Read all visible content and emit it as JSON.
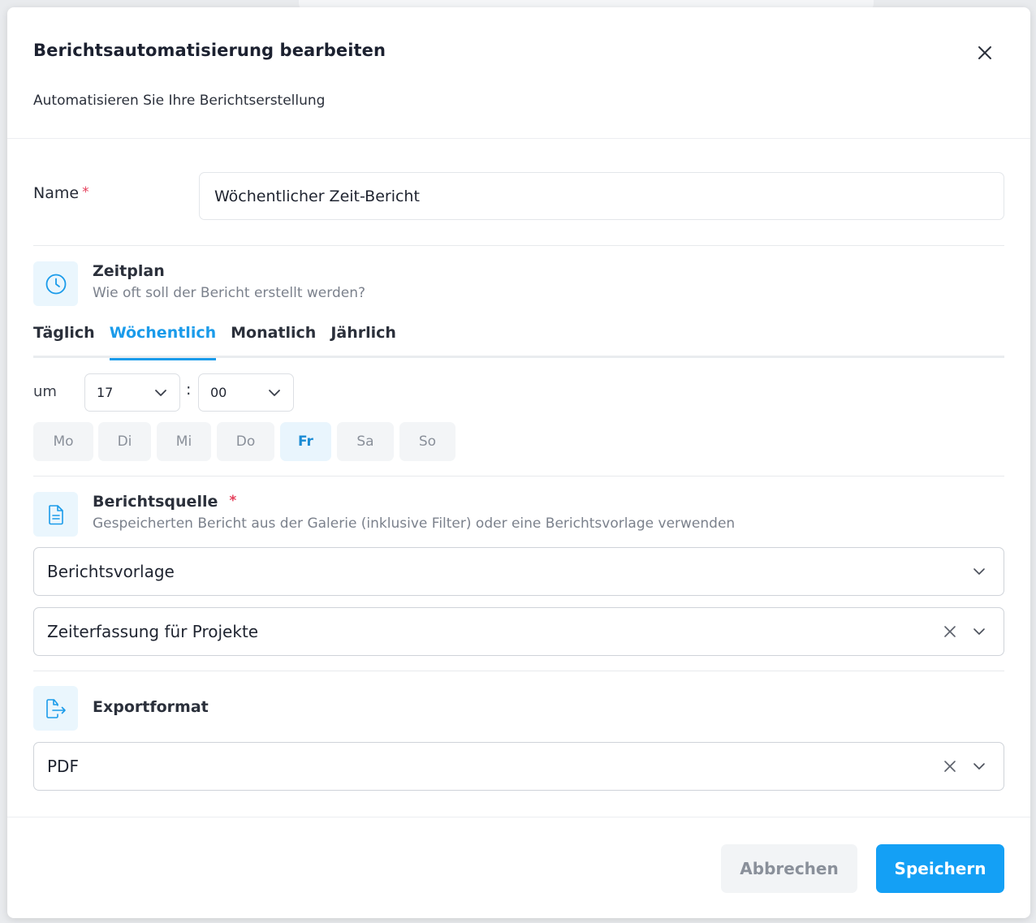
{
  "modal": {
    "title": "Berichtsautomatisierung bearbeiten",
    "subtitle": "Automatisieren Sie Ihre Berichtserstellung"
  },
  "name_field": {
    "label": "Name",
    "required": "*",
    "value": "Wöchentlicher Zeit-Bericht"
  },
  "schedule": {
    "title": "Zeitplan",
    "description": "Wie oft soll der Bericht erstellt werden?",
    "tabs": [
      {
        "label": "Täglich",
        "active": false
      },
      {
        "label": "Wöchentlich",
        "active": true
      },
      {
        "label": "Monatlich",
        "active": false
      },
      {
        "label": "Jährlich",
        "active": false
      }
    ],
    "time_label": "um",
    "hour": "17",
    "separator": ":",
    "minute": "00",
    "days": [
      {
        "label": "Mo",
        "active": false
      },
      {
        "label": "Di",
        "active": false
      },
      {
        "label": "Mi",
        "active": false
      },
      {
        "label": "Do",
        "active": false
      },
      {
        "label": "Fr",
        "active": true
      },
      {
        "label": "Sa",
        "active": false
      },
      {
        "label": "So",
        "active": false
      }
    ]
  },
  "source": {
    "title": "Berichtsquelle",
    "required": "*",
    "description": "Gespeicherten Bericht aus der Galerie (inklusive Filter) oder eine Berichtsvorlage verwenden",
    "source_type": "Berichtsvorlage",
    "template": "Zeiterfassung für Projekte"
  },
  "export": {
    "title": "Exportformat",
    "format": "PDF"
  },
  "footer": {
    "cancel_label": "Abbrechen",
    "save_label": "Speichern"
  },
  "colors": {
    "accent": "#1a9bea",
    "primary_button": "#14a0f5",
    "required": "#e53e5a",
    "icon_bg": "#eaf6fd"
  }
}
